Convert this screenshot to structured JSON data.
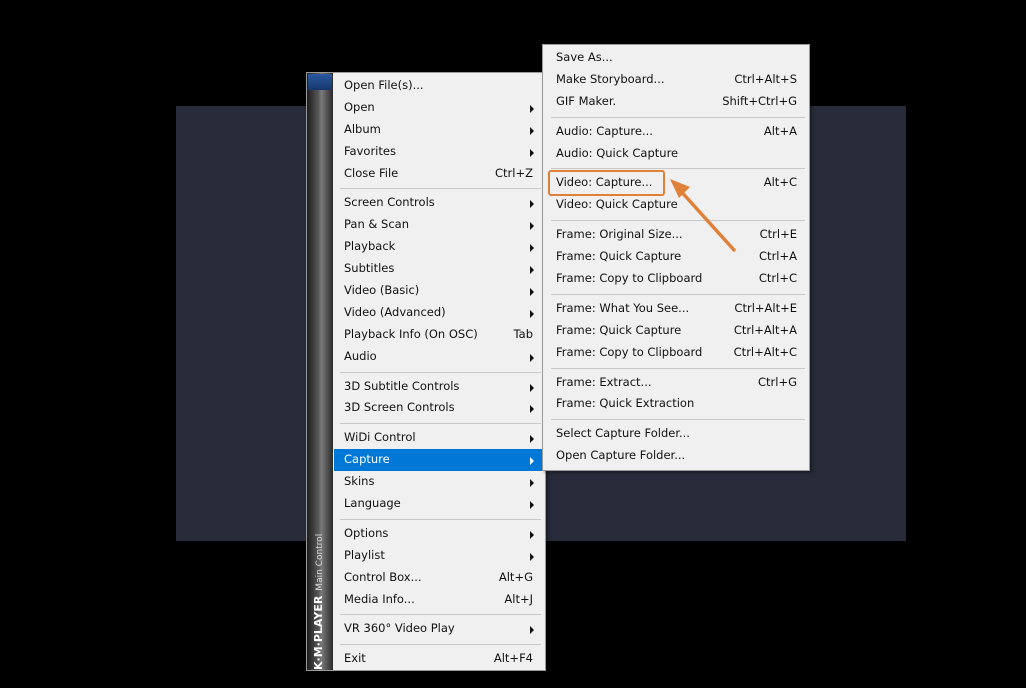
{
  "main_menu": {
    "brand": "K·M·PLAYER",
    "brand_sub": "Main Control",
    "groups": [
      [
        {
          "label": "Open File(s)...",
          "shortcut": "",
          "submenu": false
        },
        {
          "label": "Open",
          "shortcut": "",
          "submenu": true
        },
        {
          "label": "Album",
          "shortcut": "",
          "submenu": true
        },
        {
          "label": "Favorites",
          "shortcut": "",
          "submenu": true
        },
        {
          "label": "Close File",
          "shortcut": "Ctrl+Z",
          "submenu": false
        }
      ],
      [
        {
          "label": "Screen Controls",
          "shortcut": "",
          "submenu": true
        },
        {
          "label": "Pan & Scan",
          "shortcut": "",
          "submenu": true
        },
        {
          "label": "Playback",
          "shortcut": "",
          "submenu": true
        },
        {
          "label": "Subtitles",
          "shortcut": "",
          "submenu": true
        },
        {
          "label": "Video (Basic)",
          "shortcut": "",
          "submenu": true
        },
        {
          "label": "Video (Advanced)",
          "shortcut": "",
          "submenu": true
        },
        {
          "label": "Playback Info (On OSC)",
          "shortcut": "Tab",
          "submenu": false
        },
        {
          "label": "Audio",
          "shortcut": "",
          "submenu": true
        }
      ],
      [
        {
          "label": "3D Subtitle Controls",
          "shortcut": "",
          "submenu": true
        },
        {
          "label": "3D Screen Controls",
          "shortcut": "",
          "submenu": true
        }
      ],
      [
        {
          "label": "WiDi Control",
          "shortcut": "",
          "submenu": true
        },
        {
          "label": "Capture",
          "shortcut": "",
          "submenu": true,
          "active": true
        },
        {
          "label": "Skins",
          "shortcut": "",
          "submenu": true
        },
        {
          "label": "Language",
          "shortcut": "",
          "submenu": true
        }
      ],
      [
        {
          "label": "Options",
          "shortcut": "",
          "submenu": true
        },
        {
          "label": "Playlist",
          "shortcut": "",
          "submenu": true
        },
        {
          "label": "Control Box...",
          "shortcut": "Alt+G",
          "submenu": false
        },
        {
          "label": "Media Info...",
          "shortcut": "Alt+J",
          "submenu": false
        }
      ],
      [
        {
          "label": "VR 360° Video Play",
          "shortcut": "",
          "submenu": true
        }
      ],
      [
        {
          "label": "Exit",
          "shortcut": "Alt+F4",
          "submenu": false
        }
      ]
    ]
  },
  "capture_menu": {
    "groups": [
      [
        {
          "label": "Save As...",
          "shortcut": ""
        },
        {
          "label": "Make Storyboard...",
          "shortcut": "Ctrl+Alt+S"
        },
        {
          "label": "GIF Maker.",
          "shortcut": "Shift+Ctrl+G"
        }
      ],
      [
        {
          "label": "Audio: Capture...",
          "shortcut": "Alt+A"
        },
        {
          "label": "Audio: Quick Capture",
          "shortcut": ""
        }
      ],
      [
        {
          "label": "Video: Capture...",
          "shortcut": "Alt+C",
          "highlighted": true
        },
        {
          "label": "Video: Quick Capture",
          "shortcut": ""
        }
      ],
      [
        {
          "label": "Frame: Original Size...",
          "shortcut": "Ctrl+E"
        },
        {
          "label": "Frame: Quick Capture",
          "shortcut": "Ctrl+A"
        },
        {
          "label": "Frame: Copy to Clipboard",
          "shortcut": "Ctrl+C"
        }
      ],
      [
        {
          "label": "Frame: What You See...",
          "shortcut": "Ctrl+Alt+E"
        },
        {
          "label": "Frame: Quick Capture",
          "shortcut": "Ctrl+Alt+A"
        },
        {
          "label": "Frame: Copy to Clipboard",
          "shortcut": "Ctrl+Alt+C"
        }
      ],
      [
        {
          "label": "Frame: Extract...",
          "shortcut": "Ctrl+G"
        },
        {
          "label": "Frame: Quick Extraction",
          "shortcut": ""
        }
      ],
      [
        {
          "label": "Select Capture Folder...",
          "shortcut": ""
        },
        {
          "label": "Open Capture Folder...",
          "shortcut": ""
        }
      ]
    ]
  },
  "colors": {
    "active_item": "#0078d7",
    "annotation": "#e0813a",
    "video_background": "#272b3a"
  }
}
